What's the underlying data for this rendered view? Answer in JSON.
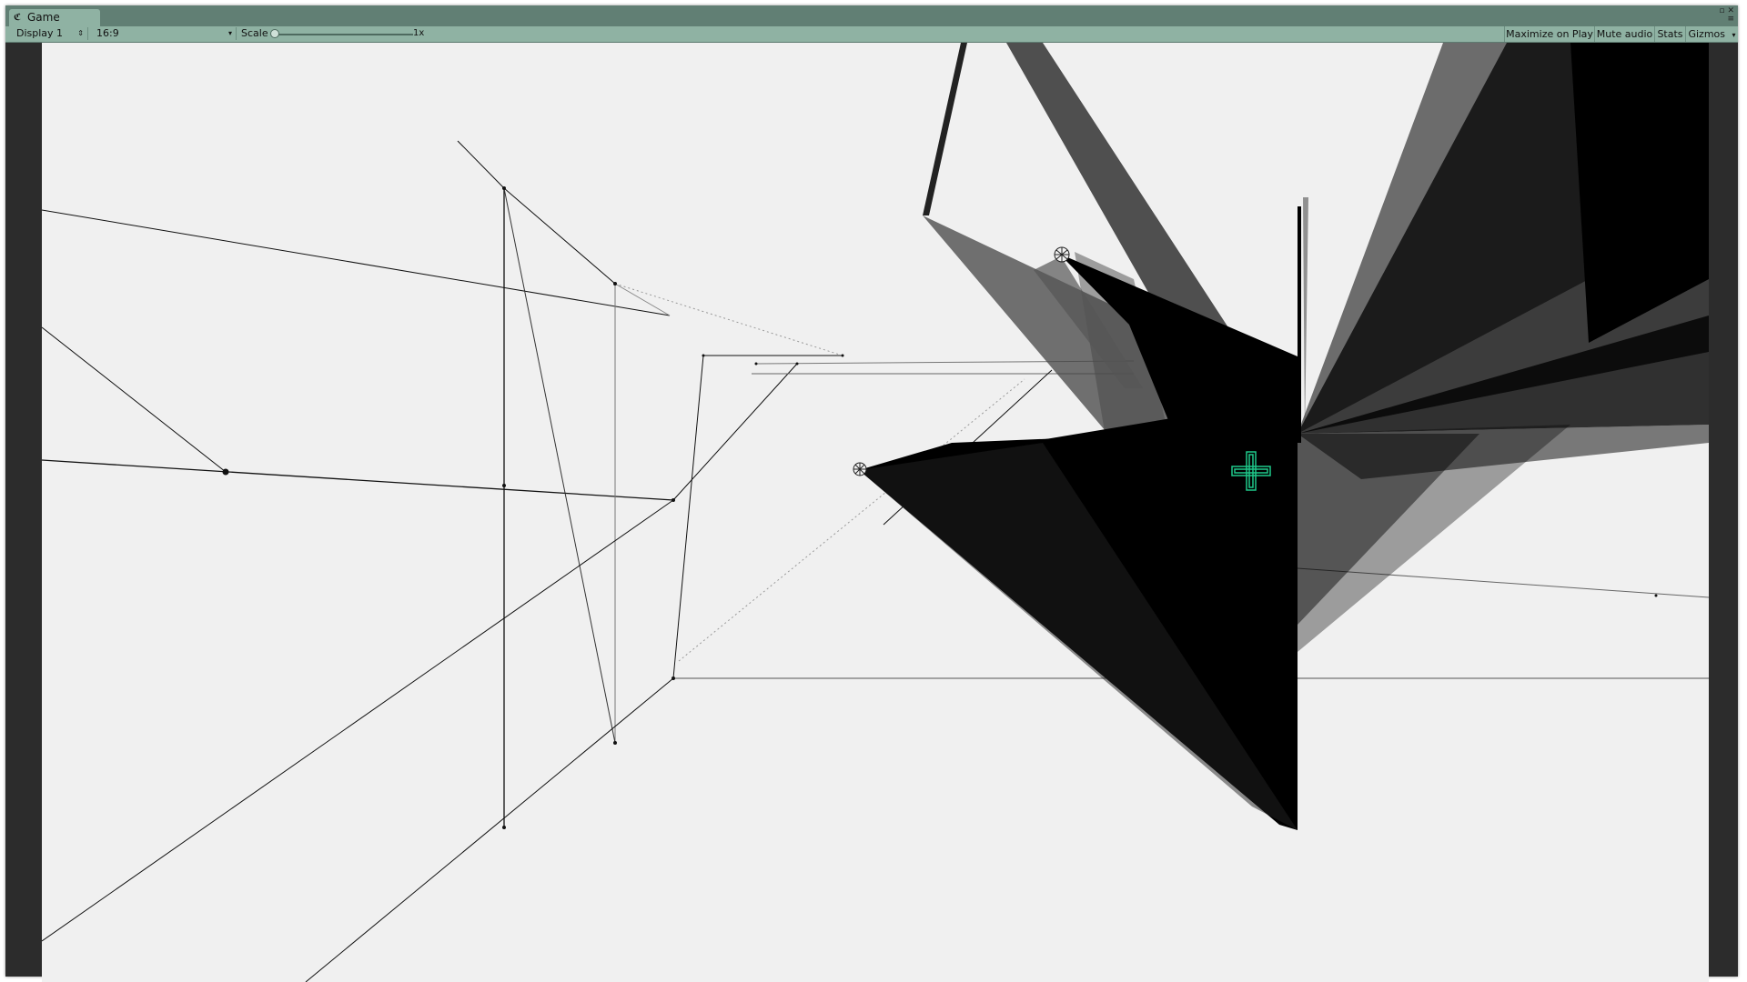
{
  "window": {
    "tab_title": "Game",
    "tab_icon": "unity-game-icon"
  },
  "toolbar": {
    "display": "Display 1",
    "aspect": "16:9",
    "scale_label": "Scale",
    "scale_value": "1x",
    "maximize_on_play": "Maximize on Play",
    "mute_audio": "Mute audio",
    "stats": "Stats",
    "gizmos": "Gizmos"
  },
  "colors": {
    "tab_bar": "#617f74",
    "toolbar": "#8fb2a3",
    "viewport_bg": "#f0f0f0",
    "editor_margin": "#2c2c2c",
    "gizmo": "#1fc98a"
  },
  "scene": {
    "gizmo_icon": "transform-cross-gizmo-icon"
  }
}
